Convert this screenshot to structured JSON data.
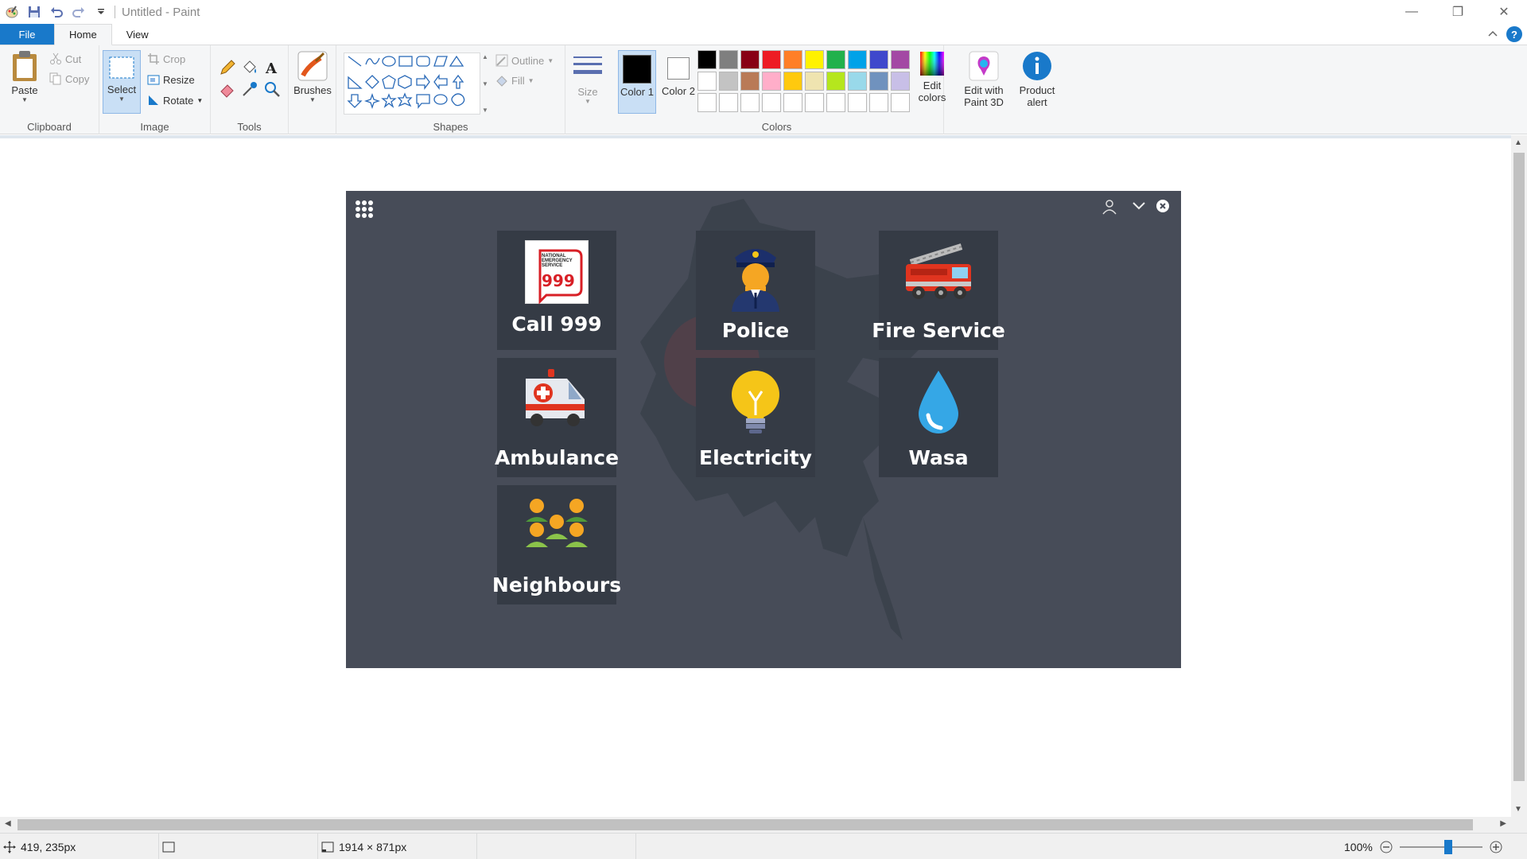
{
  "window": {
    "title": "Untitled - Paint",
    "controls": [
      "—",
      "❐",
      "✕"
    ]
  },
  "ribbon": {
    "tabs": [
      {
        "label": "File"
      },
      {
        "label": "Home"
      },
      {
        "label": "View"
      }
    ],
    "help_label": "?",
    "groups": {
      "clipboard": {
        "label": "Clipboard",
        "paste": "Paste",
        "cut": "Cut",
        "copy": "Copy"
      },
      "image": {
        "label": "Image",
        "select": "Select",
        "crop": "Crop",
        "resize": "Resize",
        "rotate": "Rotate"
      },
      "tools": {
        "label": "Tools"
      },
      "brushes": {
        "label": "Brushes"
      },
      "shapes": {
        "label": "Shapes",
        "outline": "Outline",
        "fill": "Fill"
      },
      "size": {
        "label": "Size"
      },
      "colors": {
        "label": "Colors",
        "color1": "Color 1",
        "color2": "Color 2",
        "edit_colors": "Edit colors",
        "color1_value": "#000000",
        "color2_value": "#ffffff",
        "palette": [
          "#000000",
          "#7f7f7f",
          "#880015",
          "#ed1c24",
          "#ff7f27",
          "#fff200",
          "#22b14c",
          "#00a2e8",
          "#3f48cc",
          "#a349a4",
          "#ffffff",
          "#c3c3c3",
          "#b97a57",
          "#ffaec9",
          "#ffc90e",
          "#efe4b0",
          "#b5e61d",
          "#99d9ea",
          "#7092be",
          "#c8bfe7",
          "#ffffff",
          "#ffffff",
          "#ffffff",
          "#ffffff",
          "#ffffff",
          "#ffffff",
          "#ffffff",
          "#ffffff",
          "#ffffff",
          "#ffffff"
        ]
      },
      "paint3d": {
        "label": "Edit with Paint 3D"
      },
      "product_alert": {
        "label": "Product alert"
      }
    }
  },
  "canvas_content": {
    "background": "#474c58",
    "tile_color": "#353b45",
    "tiles": [
      {
        "label": "Call 999",
        "icon": "national-emergency-999-icon",
        "badge_text": "NATIONAL EMERGENCY SERVICE",
        "badge_number": "999"
      },
      {
        "label": "Police",
        "icon": "police-officer-icon"
      },
      {
        "label": "Fire Service",
        "icon": "fire-truck-icon"
      },
      {
        "label": "Ambulance",
        "icon": "ambulance-icon"
      },
      {
        "label": "Electricity",
        "icon": "light-bulb-icon"
      },
      {
        "label": "Wasa",
        "icon": "water-drop-icon"
      },
      {
        "label": "Neighbours",
        "icon": "people-group-icon"
      }
    ]
  },
  "status": {
    "cursor_position": "419, 235px",
    "canvas_size": "1914 × 871px",
    "zoom": "100%",
    "zoom_fraction": 0.6
  }
}
